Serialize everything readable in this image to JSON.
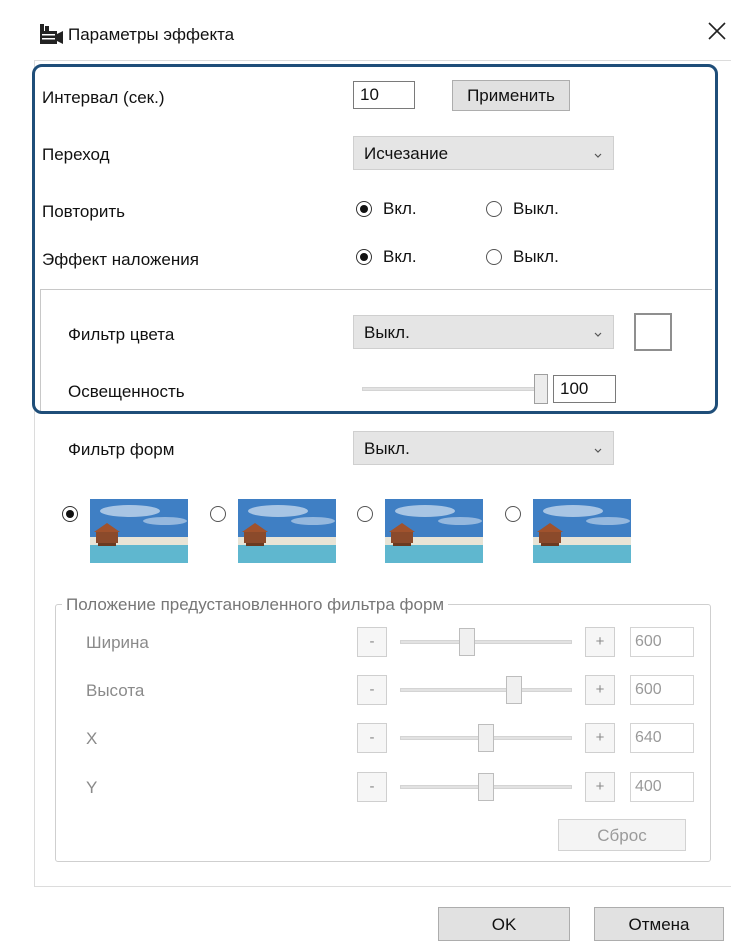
{
  "window": {
    "title": "Параметры эффекта"
  },
  "interval": {
    "label": "Интервал (сек.)",
    "value": "10",
    "apply_label": "Применить"
  },
  "transition": {
    "label": "Переход",
    "selected": "Исчезание"
  },
  "repeat": {
    "label": "Повторить",
    "on_label": "Вкл.",
    "off_label": "Выкл.",
    "selected": "on"
  },
  "overlay": {
    "label": "Эффект наложения",
    "on_label": "Вкл.",
    "off_label": "Выкл.",
    "selected": "on"
  },
  "color_filter": {
    "label": "Фильтр цвета",
    "selected": "Выкл.",
    "swatch_color": "#ffffff"
  },
  "brightness": {
    "label": "Освещенность",
    "value": "100",
    "level_percent": 100
  },
  "shape_filter": {
    "label": "Фильтр форм",
    "selected": "Выкл.",
    "selected_thumbnail": 0,
    "thumbnail_count": 4
  },
  "preset_position": {
    "group_title": "Положение предустановленного фильтра форм",
    "rows": [
      {
        "label": "Ширина",
        "minus": "-",
        "plus": "+",
        "value": "600",
        "level_percent": 38
      },
      {
        "label": "Высота",
        "minus": "-",
        "plus": "+",
        "value": "600",
        "level_percent": 68
      },
      {
        "label": "X",
        "minus": "-",
        "plus": "+",
        "value": "640",
        "level_percent": 50
      },
      {
        "label": "Y",
        "minus": "-",
        "plus": "+",
        "value": "400",
        "level_percent": 50
      }
    ],
    "reset_label": "Сброс"
  },
  "footer": {
    "ok_label": "OK",
    "cancel_label": "Отмена"
  },
  "colors": {
    "highlight_border": "#1f4e79",
    "sky": "#3f7fc4",
    "sea": "#5fb7cf",
    "sand": "#e8e4d6"
  }
}
